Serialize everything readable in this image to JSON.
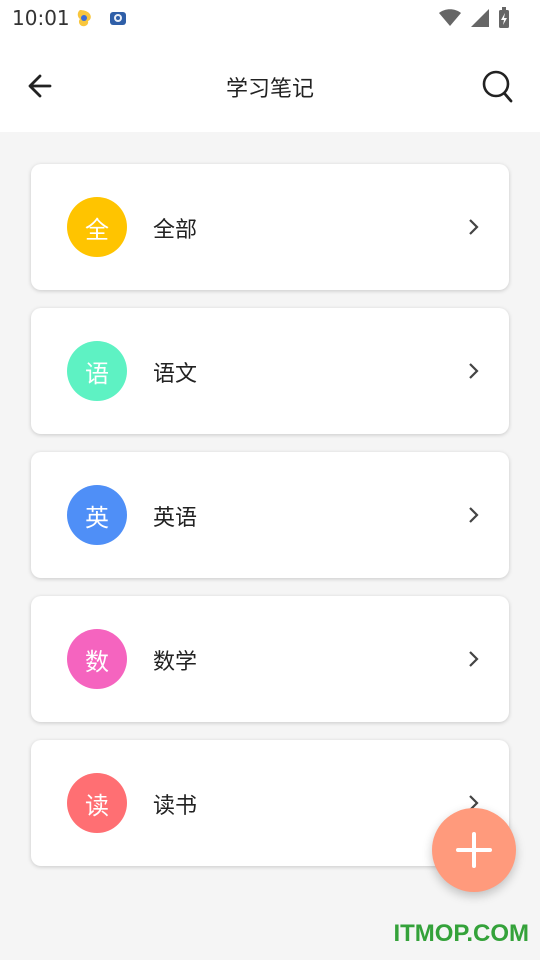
{
  "status_bar": {
    "time": "10:01"
  },
  "toolbar": {
    "title": "学习笔记",
    "back_icon": "arrow-left-icon",
    "search_icon": "search-icon"
  },
  "categories": [
    {
      "badge": "全",
      "label": "全部",
      "color": "#ffc400"
    },
    {
      "badge": "语",
      "label": "语文",
      "color": "#5ef2c3"
    },
    {
      "badge": "英",
      "label": "英语",
      "color": "#4f8ff7"
    },
    {
      "badge": "数",
      "label": "数学",
      "color": "#f564bf"
    },
    {
      "badge": "读",
      "label": "读书",
      "color": "#ff6f73"
    }
  ],
  "fab": {
    "icon": "plus-icon",
    "color": "#ff9a7c"
  },
  "watermark": "ITMOP.COM"
}
